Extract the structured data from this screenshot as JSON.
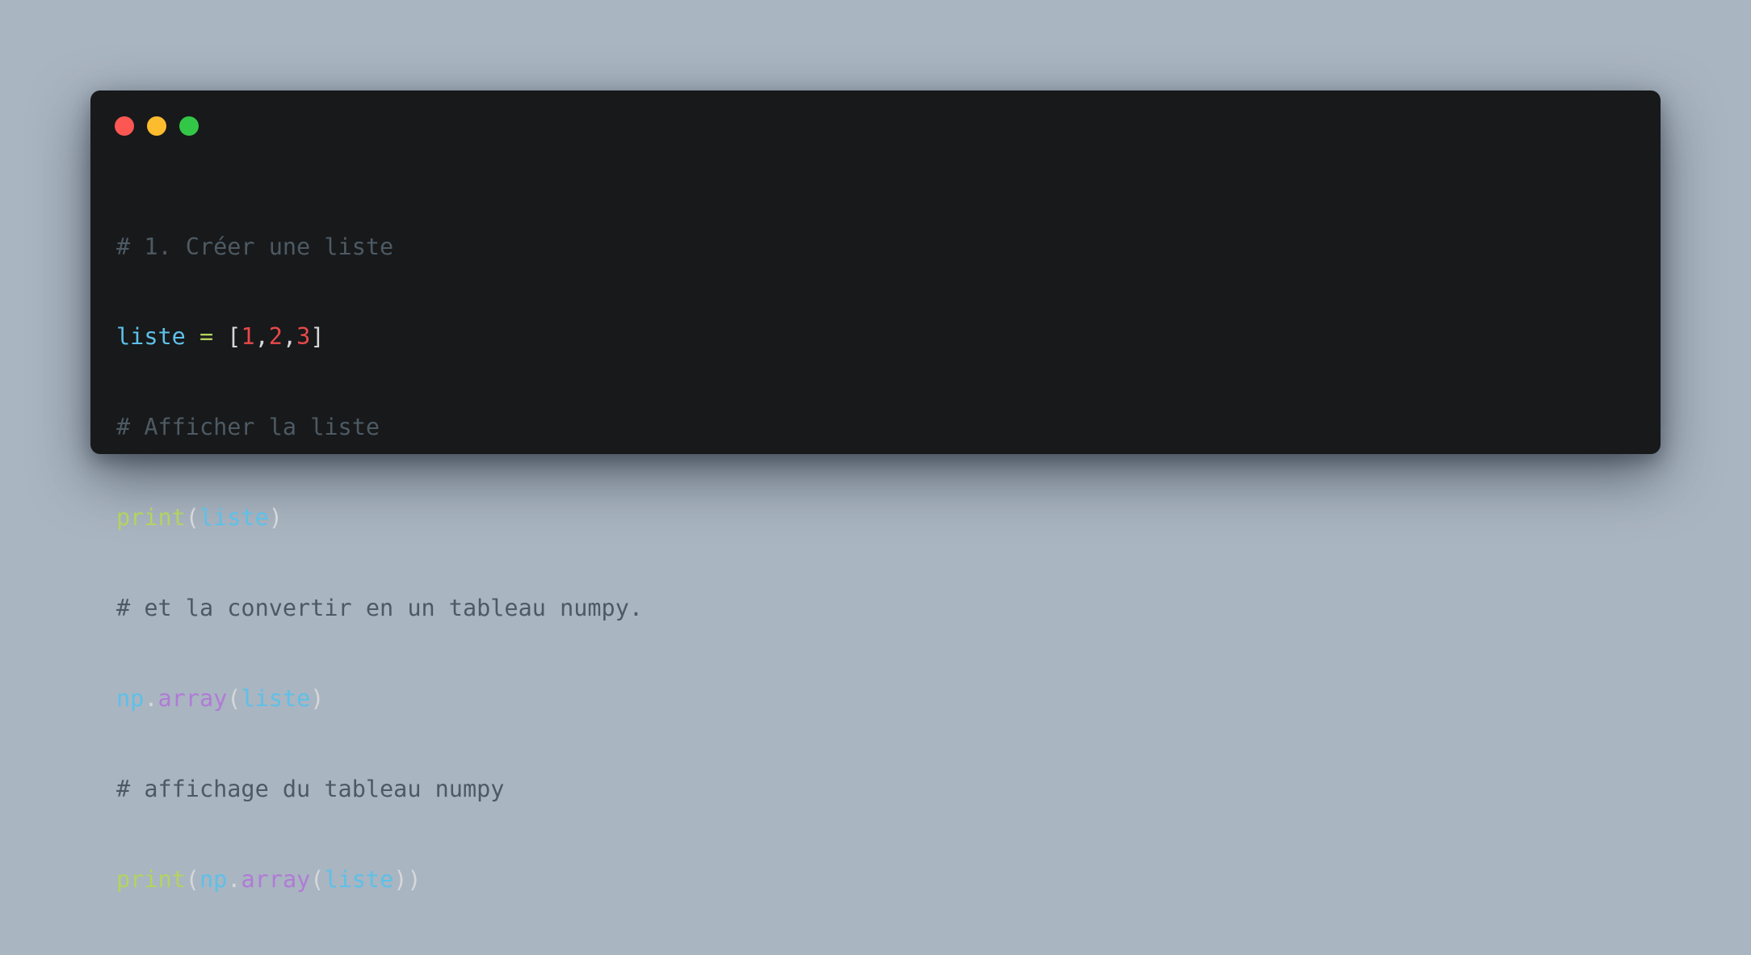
{
  "window": {
    "controls": [
      {
        "name": "close",
        "color": "#fc5753"
      },
      {
        "name": "minimize",
        "color": "#fdbc2e"
      },
      {
        "name": "zoom",
        "color": "#33c748"
      }
    ]
  },
  "colors": {
    "background": "#a9b5c1",
    "editor": "#18191b",
    "comment": "#4d5a63",
    "variable": "#5ec0e8",
    "operator": "#b4d360",
    "number": "#e8494a",
    "method": "#b07bd6",
    "punctuation": "#d6d8da"
  },
  "code": {
    "lines": [
      {
        "comment": "# 1. Créer une liste"
      },
      {
        "var": "liste",
        "eq": " = ",
        "open": "[",
        "n1": "1",
        "c1": ",",
        "n2": "2",
        "c2": ",",
        "n3": "3",
        "close": "]"
      },
      {
        "comment": "# Afficher la liste"
      },
      {
        "fn": "print",
        "open": "(",
        "arg": "liste",
        "close": ")"
      },
      {
        "comment": "# et la convertir en un tableau numpy."
      },
      {
        "mod": "np",
        "dot": ".",
        "method": "array",
        "open": "(",
        "arg": "liste",
        "close": ")"
      },
      {
        "comment": "# affichage du tableau numpy"
      },
      {
        "fn": "print",
        "open": "(",
        "mod": "np",
        "dot": ".",
        "method": "array",
        "open2": "(",
        "arg": "liste",
        "close": "))"
      }
    ]
  }
}
